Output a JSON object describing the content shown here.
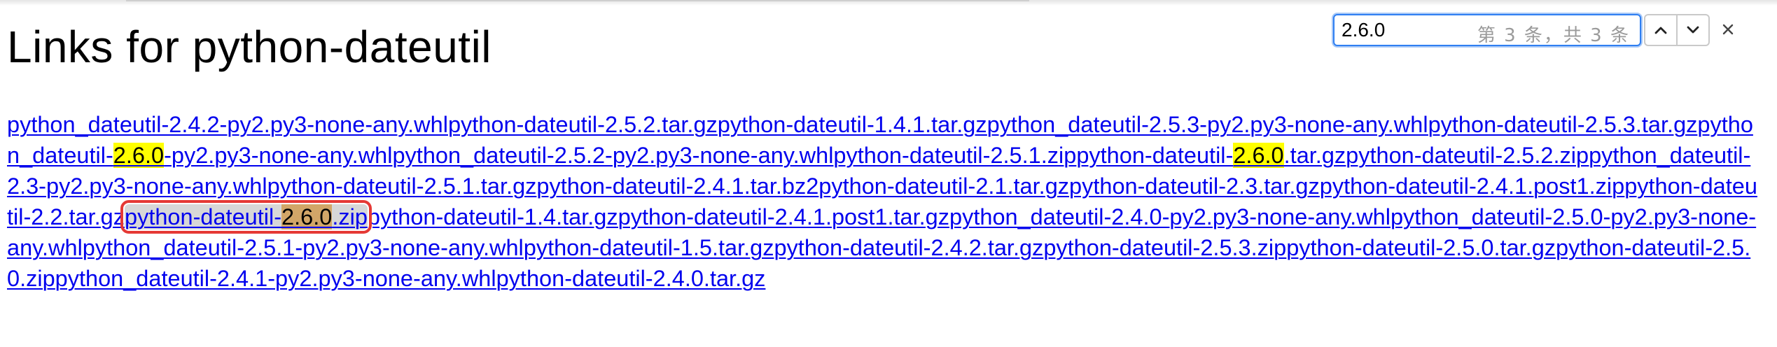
{
  "page": {
    "title": "Links for python-dateutil"
  },
  "find_bar": {
    "query": "2.6.0",
    "result_count": "第 3 条，共 3 条",
    "prev_icon": "chevron-up-icon",
    "next_icon": "chevron-down-icon",
    "close_icon": "close-icon"
  },
  "colors": {
    "link": "#0000ee",
    "match_highlight": "#ffff00",
    "active_match": "#d2a668",
    "active_outline": "#e53935",
    "find_focus": "#2f7ff2"
  },
  "links": [
    {
      "parts": [
        {
          "text": "python_dateutil-2.4.2-py2.py3-none-any.whl"
        }
      ]
    },
    {
      "parts": [
        {
          "text": "python-dateutil-2.5.2.tar.gz"
        }
      ]
    },
    {
      "parts": [
        {
          "text": "python-dateutil-1.4.1.tar.gz"
        }
      ]
    },
    {
      "parts": [
        {
          "text": "python_dateutil-2.5.3-py2.py3-none-any.whl"
        }
      ]
    },
    {
      "parts": [
        {
          "text": "python-dateutil-2.5.3.tar.gz"
        }
      ]
    },
    {
      "parts": [
        {
          "text": "python_dateutil-"
        },
        {
          "text": "2.6.0",
          "hit": true
        },
        {
          "text": "-py2.py3-none-any.whl"
        }
      ]
    },
    {
      "parts": [
        {
          "text": "python_dateutil-2.5.2-py2.py3-none-any.whl"
        }
      ]
    },
    {
      "parts": [
        {
          "text": "python-dateutil-2.5.1.zip"
        }
      ]
    },
    {
      "parts": [
        {
          "text": "python-dateutil-"
        },
        {
          "text": "2.6.0",
          "hit": true
        },
        {
          "text": ".tar.gz"
        }
      ]
    },
    {
      "parts": [
        {
          "text": "python-dateutil-2.5.2.zip"
        }
      ]
    },
    {
      "parts": [
        {
          "text": "python_dateutil-2.3-py2.py3-none-any.whl"
        }
      ]
    },
    {
      "parts": [
        {
          "text": "python-dateutil-2.5.1.tar.gz"
        }
      ]
    },
    {
      "parts": [
        {
          "text": "python-dateutil-2.4.1.tar.bz2"
        }
      ]
    },
    {
      "parts": [
        {
          "text": "python-dateutil-2.1.tar.gz"
        }
      ]
    },
    {
      "parts": [
        {
          "text": "python-dateutil-2.3.tar.gz"
        }
      ]
    },
    {
      "parts": [
        {
          "text": "python-dateutil-2.4.1.post1.zip"
        }
      ]
    },
    {
      "parts": [
        {
          "text": "python-dateutil-2.2.tar.gz"
        }
      ]
    },
    {
      "parts": [
        {
          "text": "python-dateutil-"
        },
        {
          "text": "2.6.0",
          "hit": true
        },
        {
          "text": ".zip"
        }
      ],
      "active": true
    },
    {
      "parts": [
        {
          "text": "python-dateutil-1.4.tar.gz"
        }
      ]
    },
    {
      "parts": [
        {
          "text": "python-dateutil-2.4.1.post1.tar.gz"
        }
      ]
    },
    {
      "parts": [
        {
          "text": "python_dateutil-2.4.0-py2.py3-none-any.whl"
        }
      ]
    },
    {
      "parts": [
        {
          "text": "python_dateutil-2.5.0-py2.py3-none-any.whl"
        }
      ]
    },
    {
      "parts": [
        {
          "text": "python_dateutil-2.5.1-py2.py3-none-any.whl"
        }
      ]
    },
    {
      "parts": [
        {
          "text": "python-dateutil-1.5.tar.gz"
        }
      ]
    },
    {
      "parts": [
        {
          "text": "python-dateutil-2.4.2.tar.gz"
        }
      ]
    },
    {
      "parts": [
        {
          "text": "python-dateutil-2.5.3.zip"
        }
      ]
    },
    {
      "parts": [
        {
          "text": "python-dateutil-2.5.0.tar.gz"
        }
      ]
    },
    {
      "parts": [
        {
          "text": "python-dateutil-2.5.0.zip"
        }
      ]
    },
    {
      "parts": [
        {
          "text": "python_dateutil-2.4.1-py2.py3-none-any.whl"
        }
      ]
    },
    {
      "parts": [
        {
          "text": "python-dateutil-2.4.0.tar.gz"
        }
      ]
    }
  ]
}
